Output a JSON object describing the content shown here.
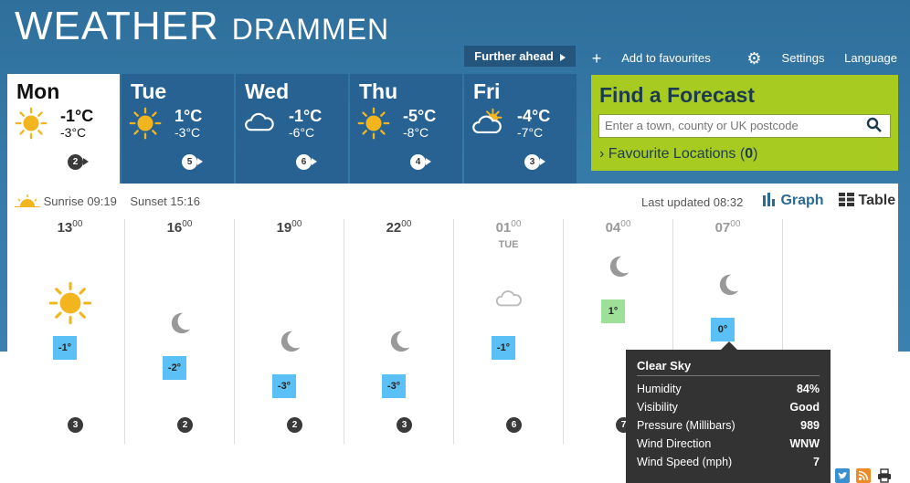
{
  "header": {
    "title": "WEATHER",
    "location": "DRAMMEN"
  },
  "nav": {
    "further_ahead": "Further ahead",
    "add_favourites": "Add to favourites",
    "settings": "Settings",
    "language": "Language"
  },
  "days": [
    {
      "name": "Mon",
      "hi": "-1°C",
      "lo": "-3°C",
      "icon": "sun-icon",
      "wind": "2"
    },
    {
      "name": "Tue",
      "hi": "1°C",
      "lo": "-3°C",
      "icon": "sun-icon",
      "wind": "5"
    },
    {
      "name": "Wed",
      "hi": "-1°C",
      "lo": "-6°C",
      "icon": "cloud-icon",
      "wind": "6"
    },
    {
      "name": "Thu",
      "hi": "-5°C",
      "lo": "-8°C",
      "icon": "sun-icon",
      "wind": "4"
    },
    {
      "name": "Fri",
      "hi": "-4°C",
      "lo": "-7°C",
      "icon": "sun-cloud-icon",
      "wind": "3"
    }
  ],
  "find": {
    "title": "Find a Forecast",
    "placeholder": "Enter a town, county or UK postcode",
    "fav_label": "Favourite Locations (",
    "fav_count": "0",
    "fav_close": ")"
  },
  "sun": {
    "sunrise": "Sunrise 09:19",
    "sunset": "Sunset 15:16"
  },
  "last_updated": "Last updated 08:32",
  "views": {
    "graph": "Graph",
    "table": "Table"
  },
  "hours": [
    {
      "h": "13",
      "m": "00",
      "sub": "",
      "icon": "sun-icon",
      "temp": "-1°",
      "wind": "3"
    },
    {
      "h": "16",
      "m": "00",
      "sub": "",
      "icon": "moon-icon",
      "temp": "-2°",
      "wind": "2"
    },
    {
      "h": "19",
      "m": "00",
      "sub": "",
      "icon": "moon-icon",
      "temp": "-3°",
      "wind": "2"
    },
    {
      "h": "22",
      "m": "00",
      "sub": "",
      "icon": "moon-icon",
      "temp": "-3°",
      "wind": "3"
    },
    {
      "h": "01",
      "m": "00",
      "sub": "TUE",
      "icon": "cloud-icon",
      "temp": "-1°",
      "wind": "6"
    },
    {
      "h": "04",
      "m": "00",
      "sub": "",
      "icon": "moon-icon",
      "temp": "1°",
      "wind": "7"
    },
    {
      "h": "07",
      "m": "00",
      "sub": "",
      "icon": "moon-icon",
      "temp": "0°",
      "wind": "7"
    }
  ],
  "tooltip": {
    "title": "Clear Sky",
    "rows": [
      {
        "label": "Humidity",
        "value": "84%"
      },
      {
        "label": "Visibility",
        "value": "Good"
      },
      {
        "label": "Pressure (Millibars)",
        "value": "989"
      },
      {
        "label": "Wind Direction",
        "value": "WNW"
      },
      {
        "label": "Wind Speed (mph)",
        "value": "7"
      }
    ]
  },
  "colors": {
    "header_blue": "#3579a7",
    "day_blue": "#276293",
    "find_green": "#a8cb21",
    "temp_blue": "#5bc0f5",
    "temp_green": "#9ee09a"
  }
}
